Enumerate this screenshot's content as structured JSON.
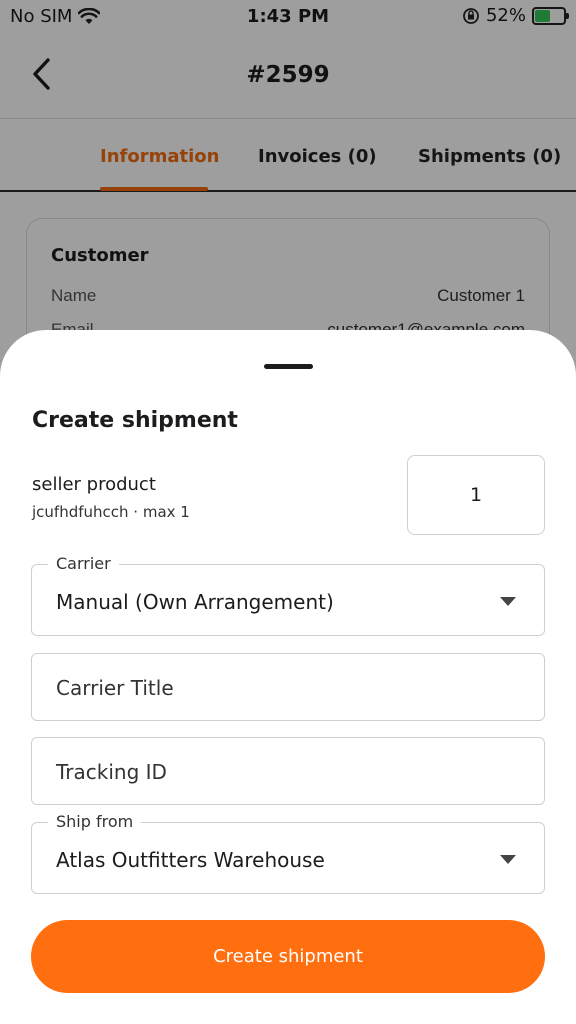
{
  "status_bar": {
    "carrier": "No SIM",
    "time": "1:43 PM",
    "battery": "52%"
  },
  "nav": {
    "title": "#2599"
  },
  "tabs": [
    {
      "label": "Information",
      "active": true
    },
    {
      "label": "Invoices (0)",
      "active": false
    },
    {
      "label": "Shipments (0)",
      "active": false
    }
  ],
  "customer_card": {
    "title": "Customer",
    "rows": [
      {
        "label": "Name",
        "value": "Customer 1"
      },
      {
        "label": "Email",
        "value": "customer1@example.com"
      }
    ]
  },
  "sheet": {
    "title": "Create shipment",
    "product": {
      "name": "seller product",
      "meta": "jcufhdfuhcch · max 1",
      "quantity": "1"
    },
    "carrier": {
      "label": "Carrier",
      "value": "Manual (Own Arrangement)"
    },
    "carrier_title": {
      "placeholder": "Carrier Title"
    },
    "tracking_id": {
      "placeholder": "Tracking ID"
    },
    "ship_from": {
      "label": "Ship from",
      "value": "Atlas Outfitters Warehouse"
    },
    "submit_label": "Create shipment"
  },
  "colors": {
    "accent": "#f26b0f",
    "button": "#ff6f0f",
    "battery": "#34c759"
  }
}
